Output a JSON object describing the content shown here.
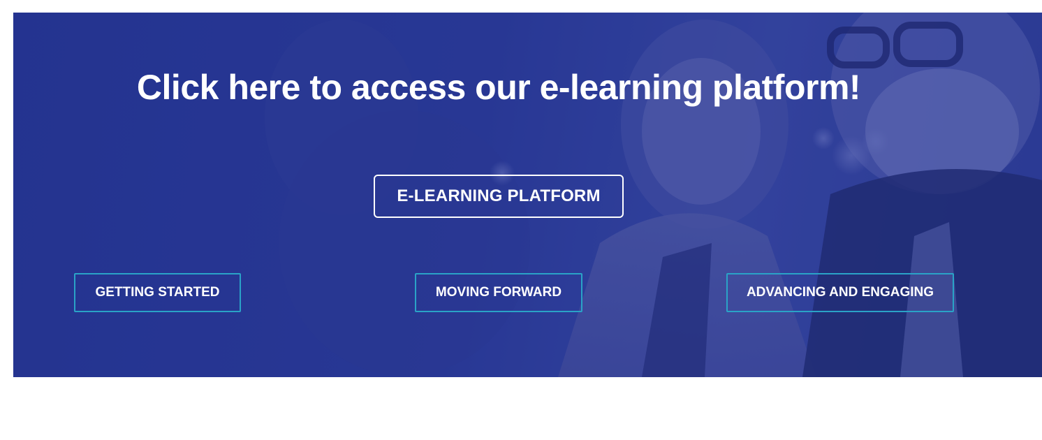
{
  "hero": {
    "title": "Click here to access our e-learning platform!",
    "cta_label": "E-LEARNING PLATFORM",
    "background_color": "#2a3a96",
    "steps": [
      {
        "label": "GETTING STARTED"
      },
      {
        "label": "MOVING FORWARD"
      },
      {
        "label": "ADVANCING AND ENGAGING"
      }
    ],
    "step_border_color": "#2aa3c7"
  }
}
